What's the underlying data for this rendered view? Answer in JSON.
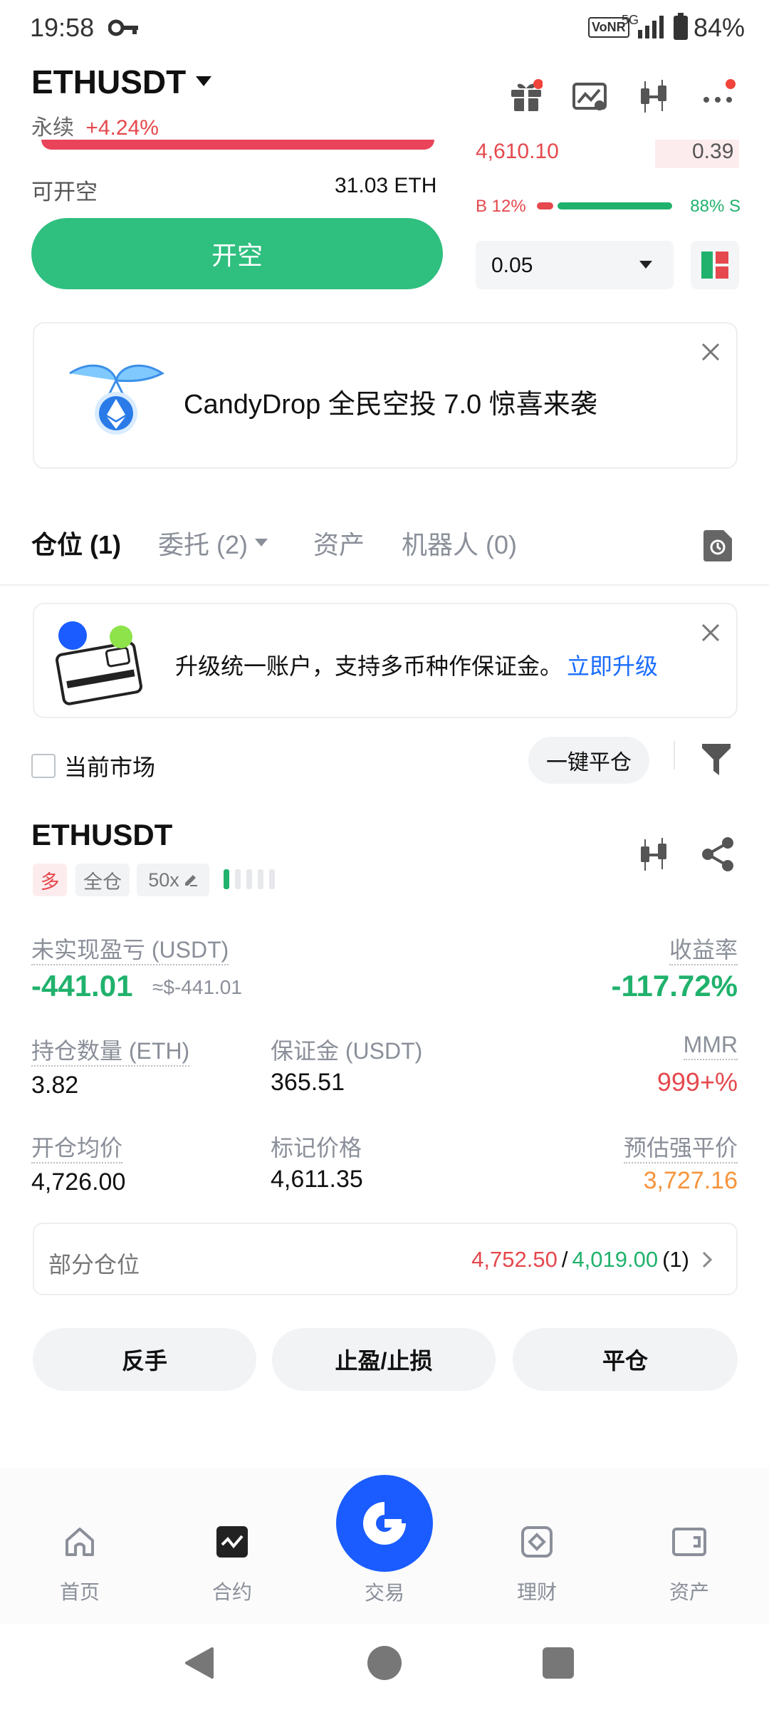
{
  "status_bar": {
    "time": "19:58",
    "network": "VoNR",
    "signal": "5G",
    "battery": "84%"
  },
  "header": {
    "symbol": "ETHUSDT",
    "contract_type": "永续",
    "change": "+4.24%"
  },
  "orderbook": {
    "price": "4,610.10",
    "qty": "0.39",
    "buy_label": "B 12%",
    "sell_label": "88% S",
    "buy_ratio": 0.12
  },
  "trade": {
    "available_label": "可开空",
    "available_value": "31.03 ETH",
    "open_short_button": "开空",
    "depth_step": "0.05"
  },
  "promo": {
    "text": "CandyDrop 全民空投 7.0 惊喜来袭"
  },
  "tabs": [
    {
      "label": "仓位 (1)",
      "active": true
    },
    {
      "label": "委托 (2)",
      "active": false
    },
    {
      "label": "资产",
      "active": false
    },
    {
      "label": "机器人 (0)",
      "active": false
    }
  ],
  "upgrade": {
    "text": "升级统一账户，支持多币种作保证金。",
    "link": "立即升级"
  },
  "filter": {
    "current_market": "当前市场",
    "close_all": "一键平仓"
  },
  "position": {
    "symbol": "ETHUSDT",
    "side": "多",
    "margin_mode": "全仓",
    "leverage": "50x",
    "pnl_label": "未实现盈亏 (USDT)",
    "pnl_value": "-441.01",
    "pnl_usd": "≈$-441.01",
    "roe_label": "收益率",
    "roe_value": "-117.72%",
    "size_label": "持仓数量 (ETH)",
    "size_value": "3.82",
    "margin_label": "保证金 (USDT)",
    "margin_value": "365.51",
    "mmr_label": "MMR",
    "mmr_value": "999+%",
    "entry_label": "开仓均价",
    "entry_value": "4,726.00",
    "mark_label": "标记价格",
    "mark_value": "4,611.35",
    "liq_label": "预估强平价",
    "liq_value": "3,727.16",
    "partial_label": "部分仓位",
    "tp_price": "4,752.50",
    "separator": "/",
    "sl_price": "4,019.00",
    "partial_count": "(1)"
  },
  "actions": {
    "reverse": "反手",
    "tpsl": "止盈/止损",
    "close": "平仓"
  },
  "bottom_nav": [
    {
      "label": "首页",
      "icon": "home-icon"
    },
    {
      "label": "合约",
      "icon": "futures-icon"
    },
    {
      "label": "交易",
      "icon": "trade-icon"
    },
    {
      "label": "理财",
      "icon": "earn-icon"
    },
    {
      "label": "资产",
      "icon": "wallet-icon"
    }
  ],
  "colors": {
    "green": "#20b26c",
    "red": "#e5484d",
    "orange": "#f5943c",
    "blue": "#1a6dff",
    "brand_blue": "#1a5cff"
  }
}
